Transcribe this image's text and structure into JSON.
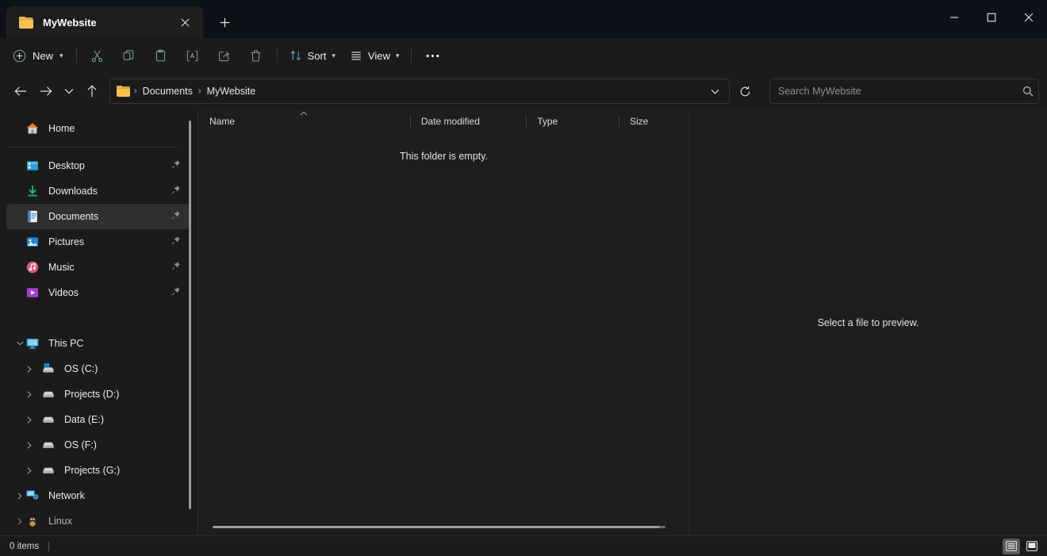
{
  "window": {
    "tab_title": "MyWebsite",
    "minimize_label": "Minimize",
    "maximize_label": "Maximize",
    "close_label": "Close",
    "new_tab_label": "New tab",
    "close_tab_label": "Close tab"
  },
  "toolbar": {
    "new_label": "New",
    "sort_label": "Sort",
    "view_label": "View",
    "more_label": "See more",
    "cut_label": "Cut",
    "copy_label": "Copy",
    "paste_label": "Paste",
    "rename_label": "Rename",
    "share_label": "Share",
    "delete_label": "Delete"
  },
  "address": {
    "back_label": "Back",
    "forward_label": "Forward",
    "recent_label": "Recent locations",
    "up_label": "Up to Documents",
    "breadcrumbs": [
      "Documents",
      "MyWebsite"
    ],
    "separator": "›",
    "dropdown_label": "Previous locations",
    "refresh_label": "Refresh"
  },
  "search": {
    "placeholder": "Search MyWebsite",
    "value": ""
  },
  "sidebar": {
    "home": {
      "label": "Home",
      "icon": "home-icon"
    },
    "quick_access": [
      {
        "label": "Desktop",
        "icon": "desktop-icon",
        "pinned": true
      },
      {
        "label": "Downloads",
        "icon": "downloads-icon",
        "pinned": true
      },
      {
        "label": "Documents",
        "icon": "documents-icon",
        "pinned": true,
        "selected": true
      },
      {
        "label": "Pictures",
        "icon": "pictures-icon",
        "pinned": true
      },
      {
        "label": "Music",
        "icon": "music-icon",
        "pinned": true
      },
      {
        "label": "Videos",
        "icon": "videos-icon",
        "pinned": true
      }
    ],
    "this_pc": {
      "label": "This PC",
      "icon": "this-pc-icon",
      "expanded": true
    },
    "drives": [
      {
        "label": "OS (C:)",
        "icon": "windows-drive-icon"
      },
      {
        "label": "Projects (D:)",
        "icon": "drive-icon"
      },
      {
        "label": "Data (E:)",
        "icon": "drive-icon"
      },
      {
        "label": "OS (F:)",
        "icon": "drive-icon"
      },
      {
        "label": "Projects (G:)",
        "icon": "drive-icon"
      }
    ],
    "network": {
      "label": "Network",
      "icon": "network-icon"
    },
    "linux": {
      "label": "Linux",
      "icon": "linux-icon"
    }
  },
  "filelist": {
    "columns": [
      {
        "label": "Name",
        "sorted": "asc"
      },
      {
        "label": "Date modified",
        "sorted": ""
      },
      {
        "label": "Type",
        "sorted": ""
      },
      {
        "label": "Size",
        "sorted": ""
      }
    ],
    "empty_message": "This folder is empty.",
    "rows": []
  },
  "preview": {
    "message": "Select a file to preview."
  },
  "statusbar": {
    "item_count": "0 items",
    "details_view_label": "Details view",
    "large_icons_view_label": "Large icons view"
  },
  "colors": {
    "window_bg": "#1b1b1b",
    "titlebar_bg": "#0d1117",
    "tab_bg": "#1e1e1e",
    "pane_bg": "#1e1e1e",
    "selection": "#2f2f2f",
    "text": "#ebebeb",
    "muted_text": "#8e8e8e",
    "folder_yellow": "#f4c24d",
    "toolbar_icon": "#7e9aa8",
    "scrollbar": "#9b9b9b"
  }
}
